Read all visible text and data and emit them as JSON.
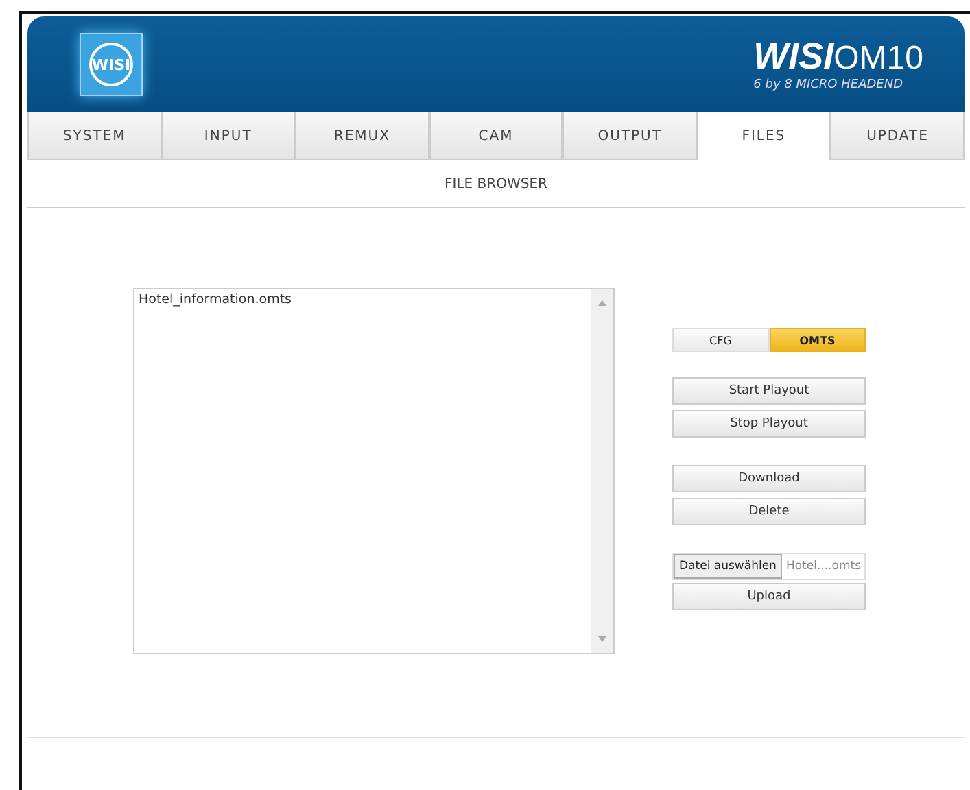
{
  "header": {
    "logo_text": "WISI",
    "brand": "WISI",
    "model": "OM10",
    "subtitle": "6 by 8 MICRO HEADEND"
  },
  "tabs": [
    {
      "label": "SYSTEM",
      "selected": false
    },
    {
      "label": "INPUT",
      "selected": false
    },
    {
      "label": "REMUX",
      "selected": false
    },
    {
      "label": "CAM",
      "selected": false
    },
    {
      "label": "OUTPUT",
      "selected": false
    },
    {
      "label": "FILES",
      "selected": true
    },
    {
      "label": "UPDATE",
      "selected": false
    }
  ],
  "section_title": "FILE BROWSER",
  "file_list": {
    "items": [
      {
        "label": "Hotel_information.omts",
        "selected": false
      }
    ]
  },
  "type_toggle": [
    {
      "label": "CFG",
      "selected": false
    },
    {
      "label": "OMTS",
      "selected": true
    }
  ],
  "playout_buttons": [
    "Start Playout",
    "Stop Playout"
  ],
  "file_buttons": [
    "Download",
    "Delete"
  ],
  "upload": {
    "choose_label": "Datei auswählen",
    "file_name": "Hotel....omts",
    "button": "Upload"
  }
}
